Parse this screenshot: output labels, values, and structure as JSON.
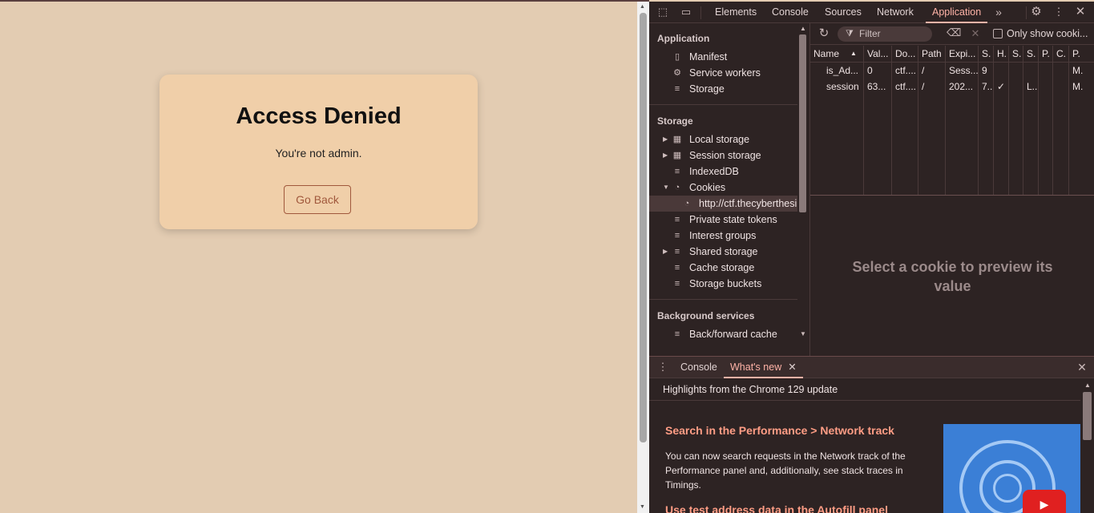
{
  "site": {
    "title": "Access Denied",
    "message": "You're not admin.",
    "button": "Go Back"
  },
  "devtools": {
    "tabs": [
      "Elements",
      "Console",
      "Sources",
      "Network",
      "Application"
    ],
    "active_tab": "Application",
    "sidebar": {
      "application_header": "Application",
      "application_items": [
        "Manifest",
        "Service workers",
        "Storage"
      ],
      "storage_header": "Storage",
      "storage_items": [
        "Local storage",
        "Session storage",
        "IndexedDB",
        "Cookies",
        "http://ctf.thecyberthesi",
        "Private state tokens",
        "Interest groups",
        "Shared storage",
        "Cache storage",
        "Storage buckets"
      ],
      "background_header": "Background services",
      "background_items": [
        "Back/forward cache"
      ]
    },
    "filter_placeholder": "Filter",
    "only_show_label": "Only show cooki...",
    "cookie_table": {
      "columns": [
        "Name",
        "Val...",
        "Do...",
        "Path",
        "Expi...",
        "S.",
        "H.",
        "S.",
        "S.",
        "P.",
        "C.",
        "P."
      ],
      "rows": [
        [
          "is_Ad...",
          "0",
          "ctf....",
          "/",
          "Sess...",
          "9",
          "",
          "",
          "",
          "",
          "",
          "M."
        ],
        [
          "session",
          "63...",
          "ctf....",
          "/",
          "202...",
          "7...",
          "✓",
          "",
          "L...",
          "",
          "",
          "M."
        ]
      ]
    },
    "preview_text": "Select a cookie to preview its value"
  },
  "drawer": {
    "tabs": [
      "Console",
      "What's new"
    ],
    "active_tab": "What's new",
    "headline": "Highlights from the Chrome 129 update",
    "item1_title": "Search in the Performance > Network track",
    "item1_body": "You can now search requests in the Network track of the Performance panel and, additionally, see stack traces in Timings.",
    "item2_title": "Use test address data in the Autofill panel"
  },
  "icons": {
    "inspect": "inspect-element-icon",
    "device": "device-toolbar-icon",
    "more_tabs": "more-tabs-icon",
    "settings": "gear-icon",
    "menu": "kebab-menu-icon",
    "close": "close-icon",
    "refresh": "refresh-icon",
    "filter": "filter-icon",
    "clear": "clear-all-icon",
    "delete": "delete-selected-icon"
  },
  "colors": {
    "page_bg": "#e3ccb2",
    "card_bg": "#f0cfa9",
    "button_border": "#a0583c",
    "devtools_bg": "#2d2323",
    "accent": "#ffb3a7",
    "link_title": "#ff9d85"
  }
}
